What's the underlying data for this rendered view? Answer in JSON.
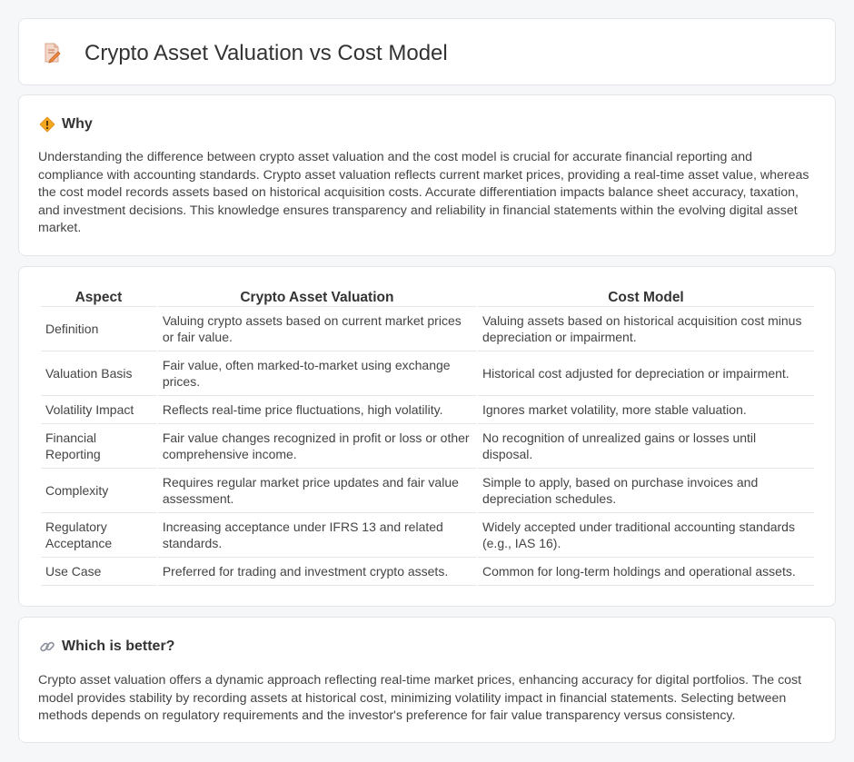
{
  "header": {
    "title": "Crypto Asset Valuation vs Cost Model",
    "icon": "document-pencil-icon"
  },
  "why": {
    "icon": "diamond-warning-icon",
    "heading": "Why",
    "text": "Understanding the difference between crypto asset valuation and the cost model is crucial for accurate financial reporting and compliance with accounting standards. Crypto asset valuation reflects current market prices, providing a real-time asset value, whereas the cost model records assets based on historical acquisition costs. Accurate differentiation impacts balance sheet accuracy, taxation, and investment decisions. This knowledge ensures transparency and reliability in financial statements within the evolving digital asset market."
  },
  "comparison": {
    "headers": [
      "Aspect",
      "Crypto Asset Valuation",
      "Cost Model"
    ],
    "rows": [
      [
        "Definition",
        "Valuing crypto assets based on current market prices or fair value.",
        "Valuing assets based on historical acquisition cost minus depreciation or impairment."
      ],
      [
        "Valuation Basis",
        "Fair value, often marked-to-market using exchange prices.",
        "Historical cost adjusted for depreciation or impairment."
      ],
      [
        "Volatility Impact",
        "Reflects real-time price fluctuations, high volatility.",
        "Ignores market volatility, more stable valuation."
      ],
      [
        "Financial Reporting",
        "Fair value changes recognized in profit or loss or other comprehensive income.",
        "No recognition of unrealized gains or losses until disposal."
      ],
      [
        "Complexity",
        "Requires regular market price updates and fair value assessment.",
        "Simple to apply, based on purchase invoices and depreciation schedules."
      ],
      [
        "Regulatory Acceptance",
        "Increasing acceptance under IFRS 13 and related standards.",
        "Widely accepted under traditional accounting standards (e.g., IAS 16)."
      ],
      [
        "Use Case",
        "Preferred for trading and investment crypto assets.",
        "Common for long-term holdings and operational assets."
      ]
    ]
  },
  "better": {
    "icon": "link-icon",
    "heading": "Which is better?",
    "text": "Crypto asset valuation offers a dynamic approach reflecting real-time market prices, enhancing accuracy for digital portfolios. The cost model provides stability by recording assets at historical cost, minimizing volatility impact in financial statements. Selecting between methods depends on regulatory requirements and the investor's preference for fair value transparency versus consistency."
  },
  "colors": {
    "accent": "#f0a030",
    "border": "#e3e5e8",
    "background": "#f6f7f9"
  }
}
